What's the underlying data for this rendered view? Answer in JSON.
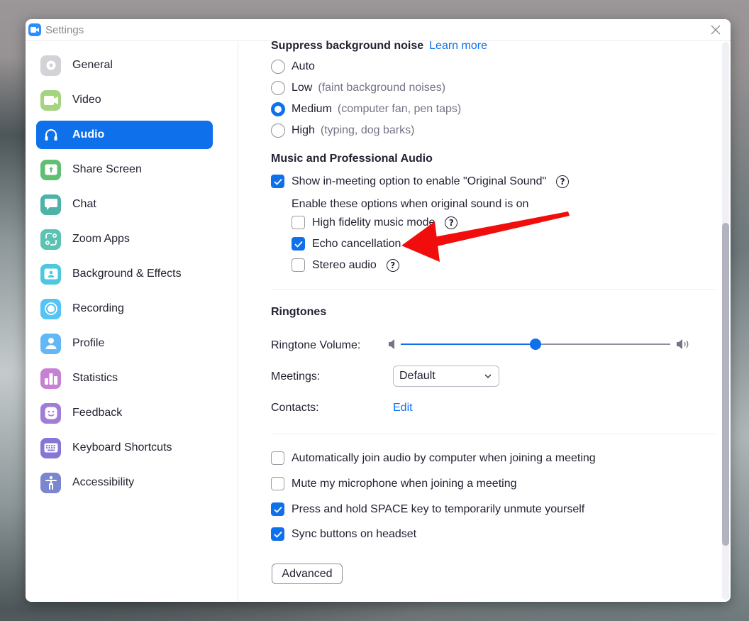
{
  "window": {
    "title": "Settings"
  },
  "colors": {
    "accent": "#0e71eb",
    "annotation_arrow": "#ff0000"
  },
  "sidebar": {
    "active": "Audio",
    "items": [
      {
        "label": "General",
        "icon": "gear-icon",
        "color": "#d2d2d7"
      },
      {
        "label": "Video",
        "icon": "video-camera-icon",
        "color": "#a5d480"
      },
      {
        "label": "Audio",
        "icon": "headphones-icon",
        "color": "#0e71eb"
      },
      {
        "label": "Share Screen",
        "icon": "share-screen-icon",
        "color": "#60bf72"
      },
      {
        "label": "Chat",
        "icon": "chat-bubble-icon",
        "color": "#4db3a6"
      },
      {
        "label": "Zoom Apps",
        "icon": "zoom-apps-icon",
        "color": "#5cc2b3"
      },
      {
        "label": "Background & Effects",
        "icon": "background-person-icon",
        "color": "#4ec8de"
      },
      {
        "label": "Recording",
        "icon": "record-icon",
        "color": "#54c3f5"
      },
      {
        "label": "Profile",
        "icon": "profile-person-icon",
        "color": "#62b7f7"
      },
      {
        "label": "Statistics",
        "icon": "bar-chart-icon",
        "color": "#c681d4"
      },
      {
        "label": "Feedback",
        "icon": "smiley-icon",
        "color": "#a07dd6"
      },
      {
        "label": "Keyboard Shortcuts",
        "icon": "keyboard-icon",
        "color": "#8677d6"
      },
      {
        "label": "Accessibility",
        "icon": "accessibility-icon",
        "color": "#7a86cf"
      }
    ]
  },
  "suppress_noise": {
    "heading": "Suppress background noise",
    "learn_more": "Learn more",
    "selected": "Medium",
    "options": [
      {
        "label": "Auto",
        "hint": ""
      },
      {
        "label": "Low",
        "hint": "(faint background noises)"
      },
      {
        "label": "Medium",
        "hint": "(computer fan, pen taps)"
      },
      {
        "label": "High",
        "hint": "(typing, dog barks)"
      }
    ]
  },
  "music_audio": {
    "heading": "Music and Professional Audio",
    "original_sound": {
      "label": "Show in-meeting option to enable \"Original Sound\"",
      "checked": true
    },
    "sub_heading": "Enable these options when original sound is on",
    "sub_options": [
      {
        "label": "High fidelity music mode",
        "checked": false
      },
      {
        "label": "Echo cancellation",
        "checked": true
      },
      {
        "label": "Stereo audio",
        "checked": false
      }
    ]
  },
  "ringtones": {
    "heading": "Ringtones",
    "volume_label": "Ringtone Volume:",
    "volume_percent": 50,
    "meetings_label": "Meetings:",
    "meetings_value": "Default",
    "contacts_label": "Contacts:",
    "contacts_link": "Edit"
  },
  "general_options": [
    {
      "label": "Automatically join audio by computer when joining a meeting",
      "checked": false
    },
    {
      "label": "Mute my microphone when joining a meeting",
      "checked": false
    },
    {
      "label": "Press and hold SPACE key to temporarily unmute yourself",
      "checked": true
    },
    {
      "label": "Sync buttons on headset",
      "checked": true
    }
  ],
  "advanced_button": "Advanced",
  "help_glyph": "?"
}
